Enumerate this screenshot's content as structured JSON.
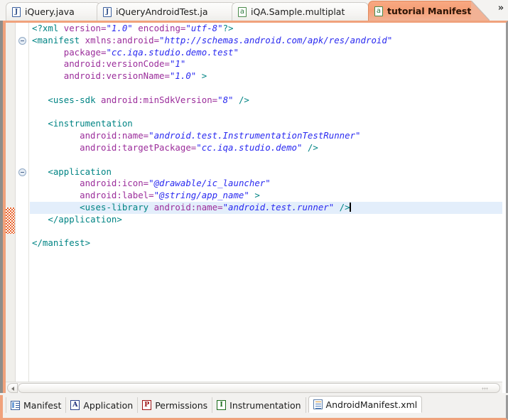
{
  "window": {
    "accent_orange": "#f0a27c",
    "active_tab_bg": "#f59f76",
    "highlight_line_bg": "#e3eefb"
  },
  "tabbar": {
    "overflow_label": "»",
    "tabs": [
      {
        "label": "iQuery.java",
        "icon": "java-file-icon",
        "icon_glyph": "J",
        "active": false
      },
      {
        "label": "iQueryAndroidTest.ja",
        "icon": "java-file-icon",
        "icon_glyph": "J",
        "active": false
      },
      {
        "label": "iQA.Sample.multiplat",
        "icon": "android-file-icon",
        "icon_glyph": "a",
        "active": false
      },
      {
        "label": "tutorial Manifest",
        "icon": "android-file-icon",
        "icon_glyph": "a",
        "active": true
      }
    ]
  },
  "editor": {
    "lines": [
      {
        "indent": 0,
        "fold": false,
        "highlight": false,
        "segments": [
          {
            "cls": "pi",
            "t": "<?xml "
          },
          {
            "cls": "attr",
            "t": "version="
          },
          {
            "cls": "val",
            "t": "\"1.0\""
          },
          {
            "cls": "plain",
            "t": " "
          },
          {
            "cls": "attr",
            "t": "encoding="
          },
          {
            "cls": "val",
            "t": "\"utf-8\""
          },
          {
            "cls": "pi",
            "t": "?>"
          }
        ]
      },
      {
        "indent": 0,
        "fold": true,
        "highlight": false,
        "segments": [
          {
            "cls": "tag",
            "t": "<manifest "
          },
          {
            "cls": "attr",
            "t": "xmlns:android="
          },
          {
            "cls": "val",
            "t": "\"http://schemas.android.com/apk/res/android\""
          }
        ]
      },
      {
        "indent": 0,
        "fold": false,
        "highlight": false,
        "segments": [
          {
            "cls": "plain",
            "t": "      "
          },
          {
            "cls": "attr",
            "t": "package="
          },
          {
            "cls": "val",
            "t": "\"cc.iqa.studio.demo.test\""
          }
        ]
      },
      {
        "indent": 0,
        "fold": false,
        "highlight": false,
        "segments": [
          {
            "cls": "plain",
            "t": "      "
          },
          {
            "cls": "attr",
            "t": "android:versionCode="
          },
          {
            "cls": "val",
            "t": "\"1\""
          }
        ]
      },
      {
        "indent": 0,
        "fold": false,
        "highlight": false,
        "segments": [
          {
            "cls": "plain",
            "t": "      "
          },
          {
            "cls": "attr",
            "t": "android:versionName="
          },
          {
            "cls": "val",
            "t": "\"1.0\""
          },
          {
            "cls": "tag",
            "t": " >"
          }
        ]
      },
      {
        "indent": 0,
        "fold": false,
        "highlight": false,
        "segments": []
      },
      {
        "indent": 0,
        "fold": false,
        "highlight": false,
        "segments": [
          {
            "cls": "plain",
            "t": "   "
          },
          {
            "cls": "tag",
            "t": "<uses-sdk "
          },
          {
            "cls": "attr",
            "t": "android:minSdkVersion="
          },
          {
            "cls": "val",
            "t": "\"8\""
          },
          {
            "cls": "tag",
            "t": " />"
          }
        ]
      },
      {
        "indent": 0,
        "fold": false,
        "highlight": false,
        "segments": []
      },
      {
        "indent": 0,
        "fold": false,
        "highlight": false,
        "segments": [
          {
            "cls": "plain",
            "t": "   "
          },
          {
            "cls": "tag",
            "t": "<instrumentation"
          }
        ]
      },
      {
        "indent": 0,
        "fold": false,
        "highlight": false,
        "segments": [
          {
            "cls": "plain",
            "t": "         "
          },
          {
            "cls": "attr",
            "t": "android:name="
          },
          {
            "cls": "val",
            "t": "\"android.test.InstrumentationTestRunner\""
          }
        ]
      },
      {
        "indent": 0,
        "fold": false,
        "highlight": false,
        "segments": [
          {
            "cls": "plain",
            "t": "         "
          },
          {
            "cls": "attr",
            "t": "android:targetPackage="
          },
          {
            "cls": "val",
            "t": "\"cc.iqa.studio.demo\""
          },
          {
            "cls": "tag",
            "t": " />"
          }
        ]
      },
      {
        "indent": 0,
        "fold": false,
        "highlight": false,
        "segments": []
      },
      {
        "indent": 0,
        "fold": true,
        "highlight": false,
        "segments": [
          {
            "cls": "plain",
            "t": "   "
          },
          {
            "cls": "tag",
            "t": "<application"
          }
        ]
      },
      {
        "indent": 0,
        "fold": false,
        "highlight": false,
        "segments": [
          {
            "cls": "plain",
            "t": "         "
          },
          {
            "cls": "attr",
            "t": "android:icon="
          },
          {
            "cls": "val",
            "t": "\"@drawable/ic_launcher\""
          }
        ]
      },
      {
        "indent": 0,
        "fold": false,
        "highlight": false,
        "segments": [
          {
            "cls": "plain",
            "t": "         "
          },
          {
            "cls": "attr",
            "t": "android:label="
          },
          {
            "cls": "val",
            "t": "\"@string/app_name\""
          },
          {
            "cls": "tag",
            "t": " >"
          }
        ]
      },
      {
        "indent": 0,
        "fold": false,
        "highlight": true,
        "caret": true,
        "segments": [
          {
            "cls": "plain",
            "t": "         "
          },
          {
            "cls": "tag",
            "t": "<uses-library "
          },
          {
            "cls": "attr",
            "t": "android:name="
          },
          {
            "cls": "val",
            "t": "\"android.test.runner\""
          },
          {
            "cls": "tag",
            "t": " />"
          }
        ]
      },
      {
        "indent": 0,
        "fold": false,
        "highlight": false,
        "segments": [
          {
            "cls": "plain",
            "t": "   "
          },
          {
            "cls": "tag",
            "t": "</application>"
          }
        ]
      },
      {
        "indent": 0,
        "fold": false,
        "highlight": false,
        "segments": []
      },
      {
        "indent": 0,
        "fold": false,
        "highlight": false,
        "segments": [
          {
            "cls": "tag",
            "t": "</manifest>"
          }
        ]
      }
    ]
  },
  "bottom_tabs": [
    {
      "label": "Manifest",
      "icon": "manifest-form-icon",
      "icon_kind": "form",
      "glyph": "",
      "selected": false
    },
    {
      "label": "Application",
      "icon": "application-icon",
      "icon_kind": "letter",
      "glyph": "A",
      "color": "blue",
      "selected": false
    },
    {
      "label": "Permissions",
      "icon": "permissions-icon",
      "icon_kind": "letter",
      "glyph": "P",
      "color": "red",
      "selected": false
    },
    {
      "label": "Instrumentation",
      "icon": "instrumentation-icon",
      "icon_kind": "letter",
      "glyph": "I",
      "color": "green",
      "selected": false
    },
    {
      "label": "AndroidManifest.xml",
      "icon": "xml-source-icon",
      "icon_kind": "xml",
      "glyph": "",
      "selected": true
    }
  ]
}
